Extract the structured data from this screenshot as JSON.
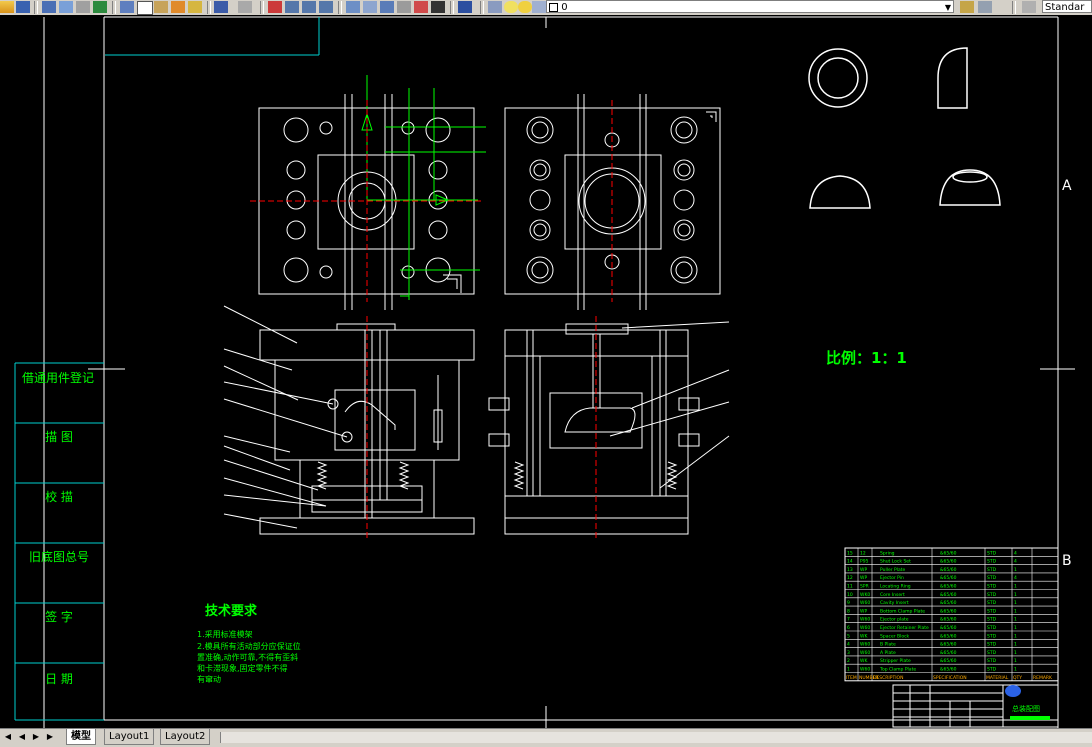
{
  "toolbar": {
    "layer_value": "0",
    "style_value": "Standar"
  },
  "drawing": {
    "stamp_rows": [
      "借通用件登记",
      "描 图",
      "校 描",
      "旧底图总号",
      "签 字",
      "日 期"
    ],
    "scale_text": "比例：1：1",
    "tech_title": "技术要求",
    "tech_lines": [
      "1.采用标准模架",
      "2.模具所有活动部分应保证位",
      "置准确,动作可靠,不得有歪斜",
      "和卡滞现象,固定零件不得",
      "有窜动"
    ],
    "grid_right_a": "A",
    "grid_right_b": "B",
    "bom_rows": [
      [
        "15",
        "12",
        "Spring",
        "&65/60",
        "STD",
        "4"
      ],
      [
        "14",
        "P95",
        "Shut Lock Set",
        "&65/60",
        "STD",
        "4"
      ],
      [
        "13",
        "WP",
        "Puller Plate",
        "&65/60",
        "STD",
        "1"
      ],
      [
        "12",
        "WP",
        "Ejector Pin",
        "&65/60",
        "STD",
        "4"
      ],
      [
        "11",
        "SPR",
        "Locating Ring",
        "&65/60",
        "STD",
        "1"
      ],
      [
        "10",
        "WK0",
        "Core Insert",
        "&65/60",
        "STD",
        "1"
      ],
      [
        "9",
        "W60",
        "Cavity Insert",
        "&65/60",
        "STD",
        "1"
      ],
      [
        "8",
        "WP",
        "Bottom Clamp Plate",
        "&65/60",
        "STD",
        "1"
      ],
      [
        "7",
        "W60",
        "Ejector plate",
        "&65/60",
        "STD",
        "1"
      ],
      [
        "6",
        "W60",
        "Ejector Retainer Plate",
        "&65/60",
        "STD",
        "1"
      ],
      [
        "5",
        "WK",
        "Spacer Block",
        "&65/60",
        "STD",
        "1"
      ],
      [
        "4",
        "W60",
        "B Plate",
        "&65/60",
        "STD",
        "1"
      ],
      [
        "3",
        "W60",
        "A Plate",
        "&65/60",
        "STD",
        "1"
      ],
      [
        "2",
        "WK",
        "Stripper Plate",
        "&65/60",
        "STD",
        "1"
      ],
      [
        "1",
        "W60",
        "Top Clamp Plate",
        "&65/60",
        "STD",
        "1"
      ]
    ],
    "bom_header": [
      "ITEM",
      "NUMBER",
      "DESCRIPTION",
      "SPECIFICATION",
      "MATERIAL",
      "QTY",
      "REMARK"
    ],
    "title_block_name": "总装配图"
  },
  "tabs": {
    "model": "模型",
    "layout1": "Layout1",
    "layout2": "Layout2"
  },
  "colors": {
    "background": "#000000",
    "lines": "#ffffff",
    "frame": "#00ffff",
    "green": "#00ff00",
    "red": "#ff0000"
  }
}
